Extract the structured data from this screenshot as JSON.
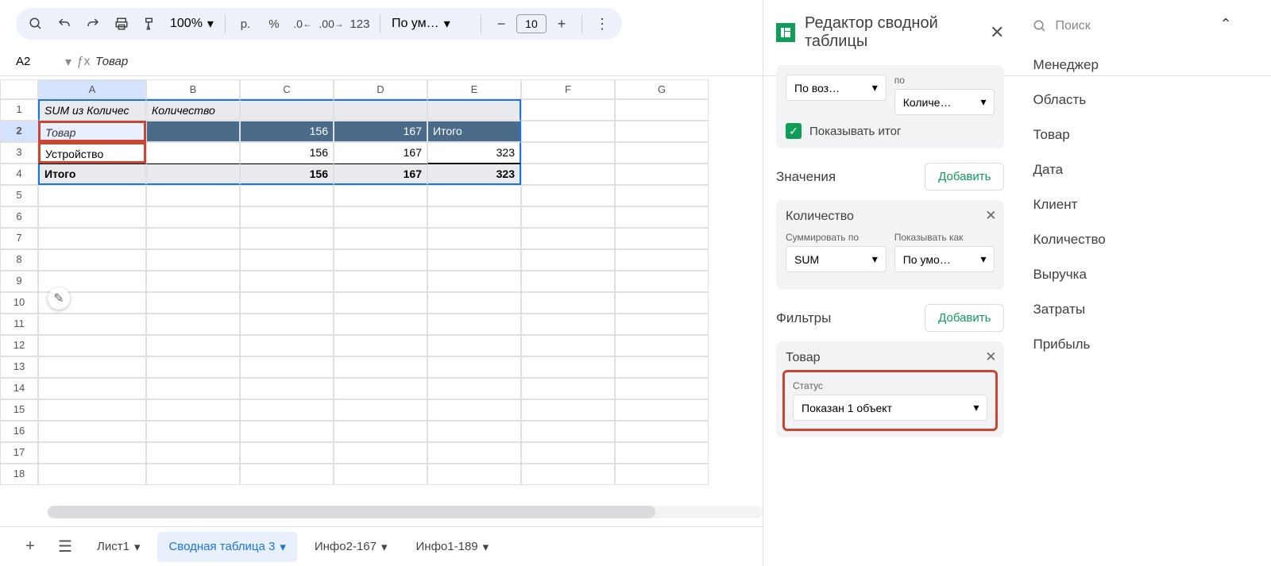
{
  "toolbar": {
    "zoom": "100%",
    "currency": "р.",
    "pct": "%",
    "num": "123",
    "font": "По ум…",
    "size": "10"
  },
  "namebox": {
    "ref": "A2",
    "fx": "Товар"
  },
  "cols": [
    "A",
    "B",
    "C",
    "D",
    "E",
    "F",
    "G"
  ],
  "rows": [
    "1",
    "2",
    "3",
    "4",
    "5",
    "6",
    "7",
    "8",
    "9",
    "10",
    "11",
    "12",
    "13",
    "14",
    "15",
    "16",
    "17",
    "18"
  ],
  "data": {
    "r1": {
      "a": "SUM из Количес",
      "b": "Количество"
    },
    "r2": {
      "a": "Товар",
      "c": "156",
      "d": "167",
      "e_lbl": "Итого"
    },
    "r3": {
      "a": "Устройство",
      "c": "156",
      "d": "167",
      "e": "323"
    },
    "r4": {
      "a": "Итого",
      "c": "156",
      "d": "167",
      "e": "323"
    }
  },
  "sheets": {
    "s1": "Лист1",
    "s2": "Сводная таблица 3",
    "s3": "Инфо2-167",
    "s4": "Инфо1-189"
  },
  "pivot": {
    "title": "Редактор сводной таблицы",
    "sort": "По воз…",
    "sort_by_lbl": "по",
    "sort_by": "Количе…",
    "show_total": "Показывать итог",
    "values_lbl": "Значения",
    "add": "Добавить",
    "val_card": "Количество",
    "sum_lbl": "Суммировать по",
    "sum": "SUM",
    "show_lbl": "Показывать как",
    "show": "По умо…",
    "filters_lbl": "Фильтры",
    "filter_card": "Товар",
    "status_lbl": "Статус",
    "status": "Показан 1 объект",
    "search": "Поиск",
    "fields": [
      "Менеджер",
      "Область",
      "Товар",
      "Дата",
      "Клиент",
      "Количество",
      "Выручка",
      "Затраты",
      "Прибыль"
    ]
  }
}
